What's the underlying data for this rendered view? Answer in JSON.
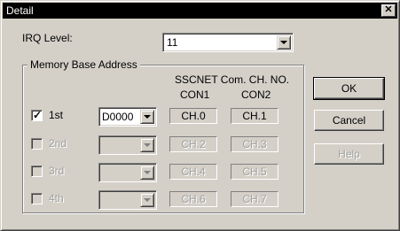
{
  "window": {
    "title": "Detail"
  },
  "irq": {
    "label": "IRQ Level:",
    "value": "11"
  },
  "memory": {
    "group_label": "Memory Base Address",
    "header_line1": "SSCNET Com. CH. NO.",
    "col1": "CON1",
    "col2": "CON2",
    "rows": [
      {
        "label": "1st",
        "checked": true,
        "address": "D0000",
        "con1": "CH.0",
        "con2": "CH.1",
        "enabled": true
      },
      {
        "label": "2nd",
        "checked": false,
        "address": "",
        "con1": "CH.2",
        "con2": "CH.3",
        "enabled": false
      },
      {
        "label": "3rd",
        "checked": false,
        "address": "",
        "con1": "CH.4",
        "con2": "CH.5",
        "enabled": false
      },
      {
        "label": "4th",
        "checked": false,
        "address": "",
        "con1": "CH.6",
        "con2": "CH.7",
        "enabled": false
      }
    ]
  },
  "buttons": {
    "ok": "OK",
    "cancel": "Cancel",
    "help": "Help"
  },
  "icons": {
    "close": "close-icon",
    "check": "checkmark-icon",
    "dropdown": "chevron-down-icon"
  }
}
